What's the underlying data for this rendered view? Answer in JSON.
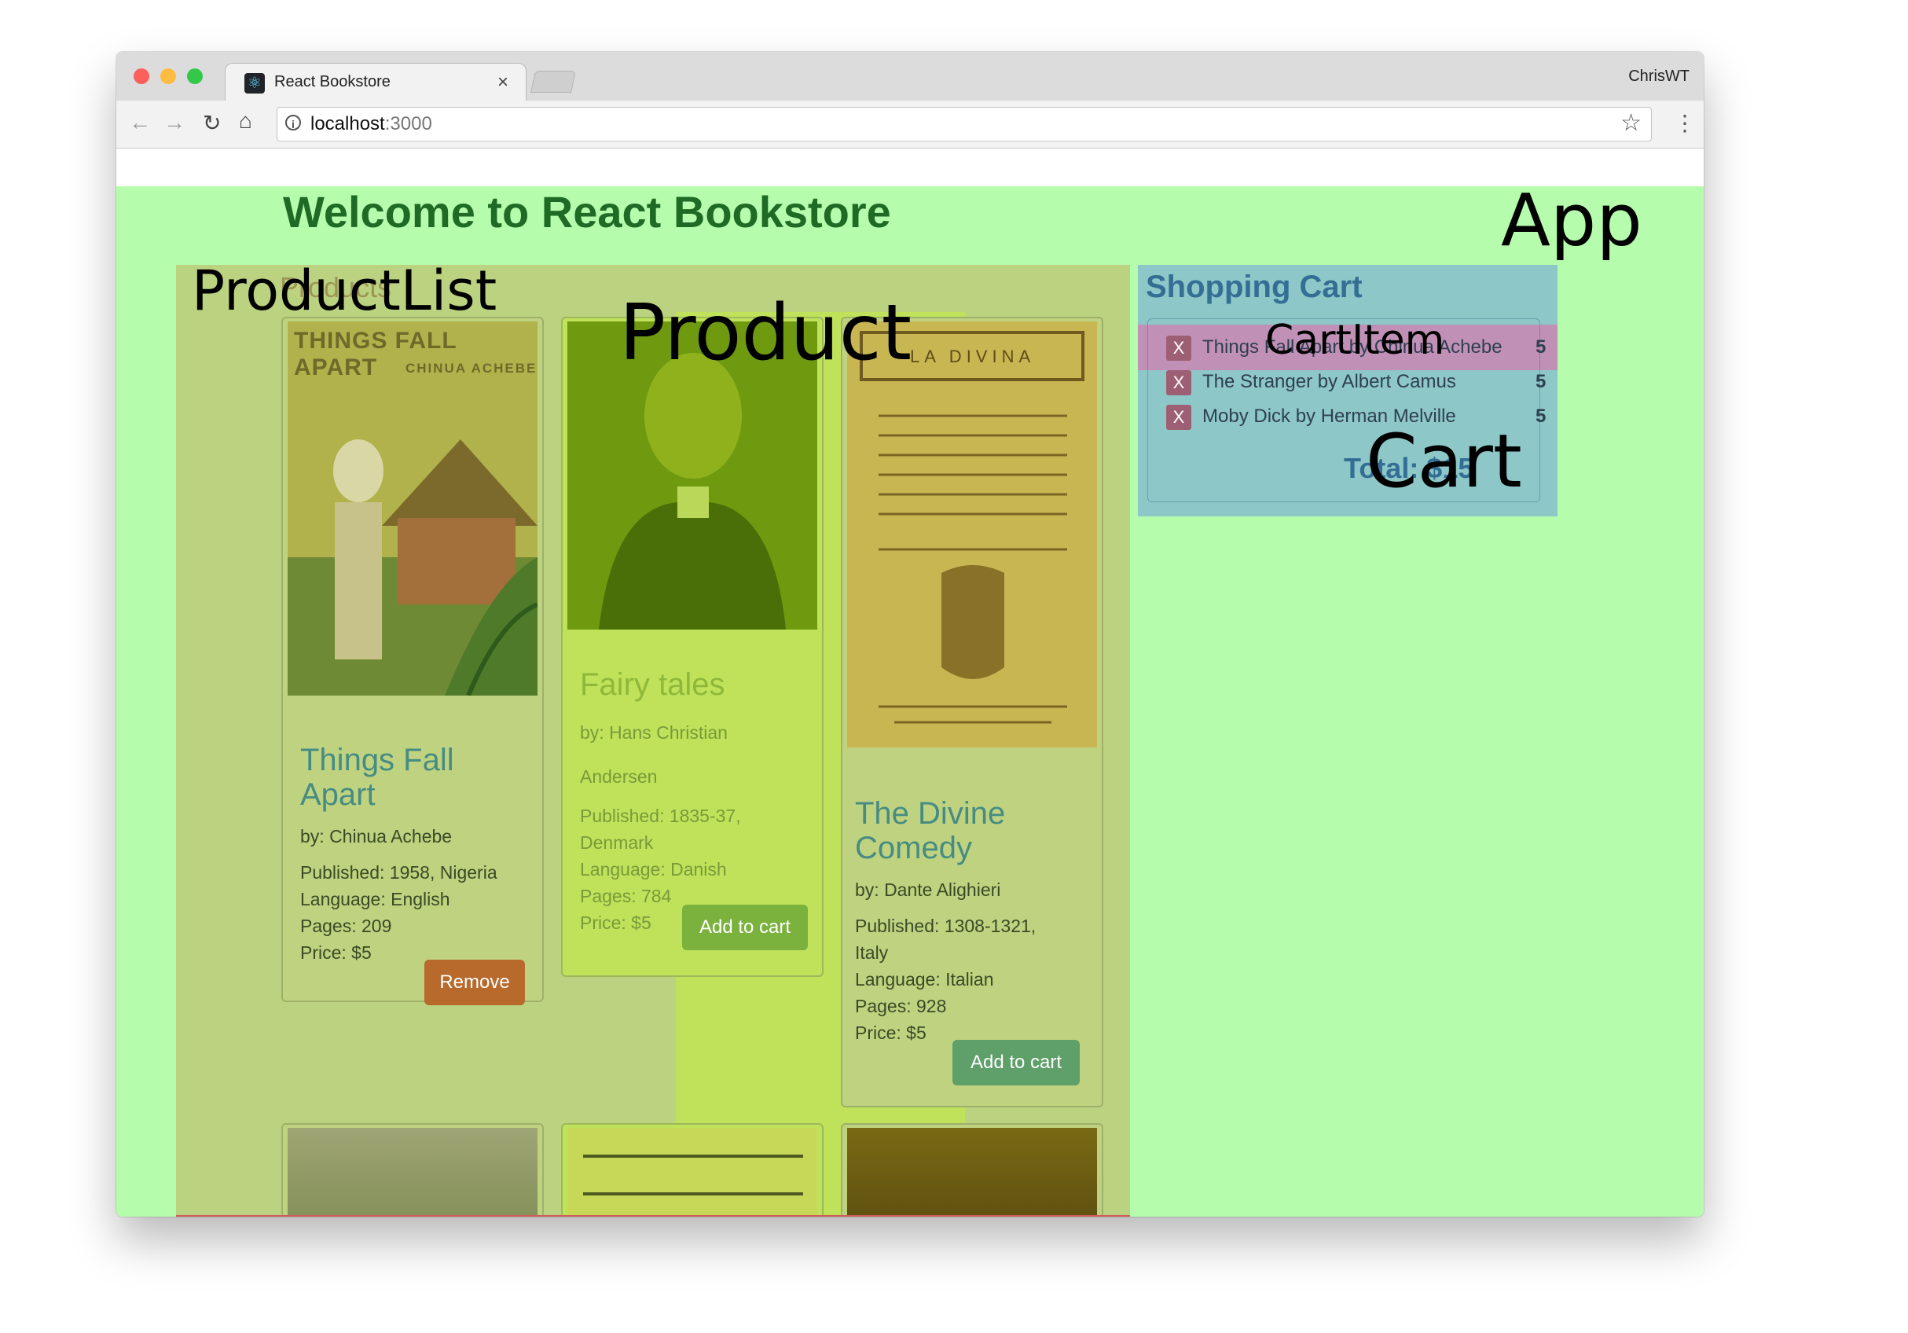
{
  "browser": {
    "tab_title": "React Bookstore",
    "tab_close": "×",
    "profile_name": "ChrisWT",
    "url_host": "localhost",
    "url_port": ":3000"
  },
  "app": {
    "welcome": "Welcome to React Bookstore",
    "label": "App"
  },
  "product_list": {
    "heading": "Products",
    "label": "ProductList",
    "product_label": "Product",
    "books": [
      {
        "title_line1": "Things Fall",
        "title_line2": "Apart",
        "cover_title": "THINGS FALL APART",
        "cover_author": "CHINUA ACHEBE",
        "by": "by: Chinua Achebe",
        "published": "Published: 1958, Nigeria",
        "language": "Language: English",
        "pages": "Pages: 209",
        "price": "Price: $5",
        "button": "Remove"
      },
      {
        "title_line1": "Fairy tales",
        "by_line1": "by: Hans Christian",
        "by_line2": "Andersen",
        "published_line1": "Published: 1835-37,",
        "published_line2": "Denmark",
        "language": "Language: Danish",
        "pages": "Pages: 784",
        "price": "Price: $5",
        "button": "Add to cart"
      },
      {
        "title_line1": "The Divine",
        "title_line2": "Comedy",
        "cover_title": "LA DIVINA",
        "by": "by: Dante Alighieri",
        "published_line1": "Published: 1308-1321,",
        "published_line2": "Italy",
        "language": "Language: Italian",
        "pages": "Pages: 928",
        "price": "Price: $5",
        "button": "Add to cart"
      }
    ]
  },
  "cart": {
    "title": "Shopping Cart",
    "label": "Cart",
    "item_label": "CartItem",
    "remove_symbol": "X",
    "items": [
      {
        "text": "Things Fall Apart by Chinua Achebe",
        "qty": "5"
      },
      {
        "text": "The Stranger by Albert Camus",
        "qty": "5"
      },
      {
        "text": "Moby Dick by Herman Melville",
        "qty": "5"
      }
    ],
    "total": "Total: $15"
  },
  "colors": {
    "app_bg": "#b6fcad",
    "productlist_bg": "#bbd380",
    "product_bg": "#bfe25a",
    "cart_bg": "#8dc7c8",
    "cartitem_bg": "#c190b6",
    "remove_button": "#b76a2c",
    "add_button": "#5ea957"
  },
  "icons": [
    "back-arrow-icon",
    "forward-arrow-icon",
    "reload-icon",
    "home-icon",
    "info-icon",
    "star-icon",
    "kebab-menu-icon",
    "react-favicon-icon"
  ]
}
